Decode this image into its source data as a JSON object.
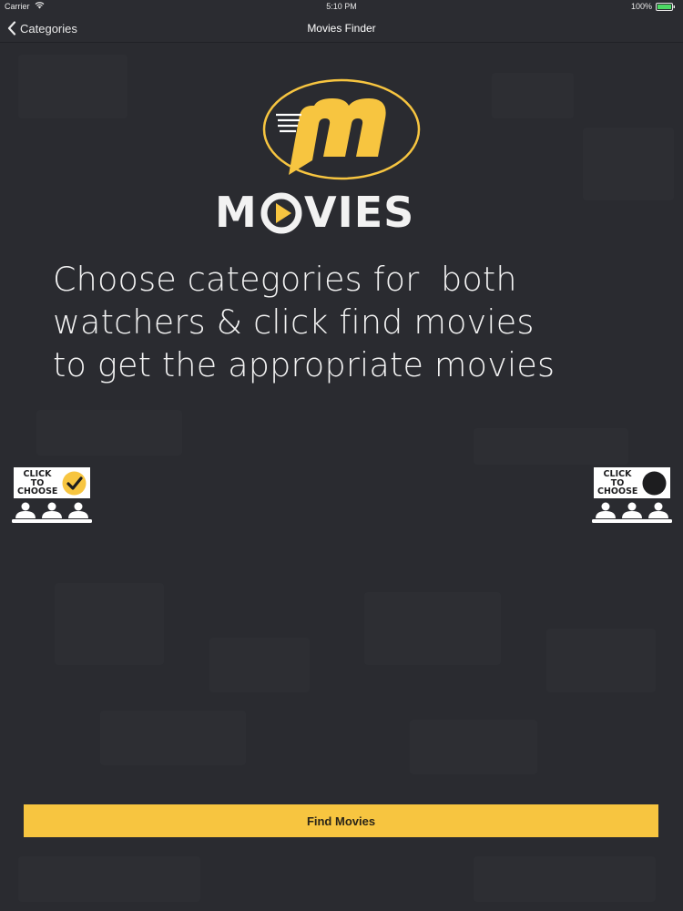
{
  "status_bar": {
    "carrier": "Carrier",
    "time": "5:10 PM",
    "battery_percent": "100%"
  },
  "nav": {
    "back_label": "Categories",
    "title": "Movies Finder"
  },
  "logo": {
    "wordmark_prefix": "M",
    "wordmark_suffix": "VIES",
    "accent_color": "#f7c540"
  },
  "instructions": {
    "line1": "Choose categories for  both",
    "line2": "watchers & click find movies",
    "line3": "to get the appropriate movies"
  },
  "watchers": [
    {
      "label_line1": "CLICK",
      "label_line2": "TO",
      "label_line3": "CHOOSE",
      "state": "selected"
    },
    {
      "label_line1": "CLICK",
      "label_line2": "TO",
      "label_line3": "CHOOSE",
      "state": "unselected"
    }
  ],
  "find_button": {
    "label": "Find Movies",
    "color": "#f7c540"
  },
  "colors": {
    "background": "#2a2b30",
    "accent": "#f7c540"
  }
}
